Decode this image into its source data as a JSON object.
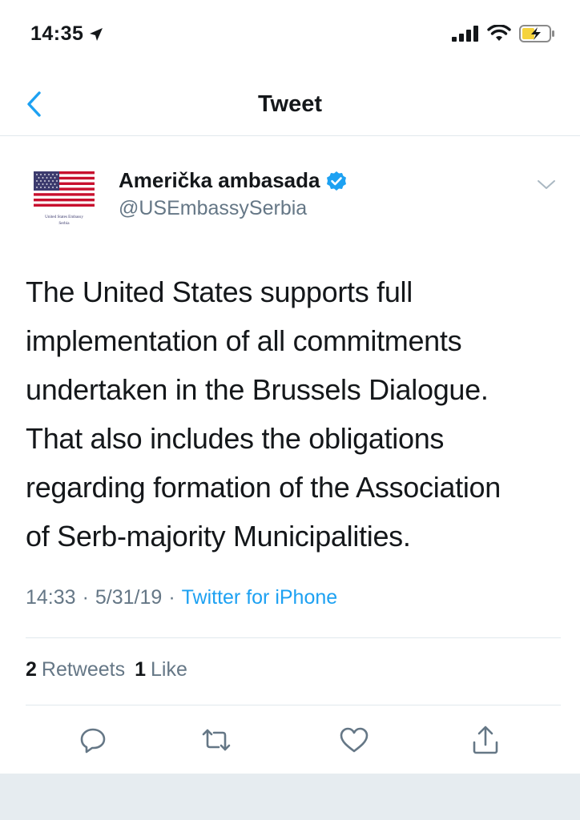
{
  "status_bar": {
    "time": "14:35",
    "icons": [
      "location-arrow-icon",
      "signal-icon",
      "wifi-icon",
      "battery-charging-icon"
    ]
  },
  "nav": {
    "title": "Tweet",
    "back_icon": "chevron-left-icon"
  },
  "tweet": {
    "author_name": "Američka ambasada",
    "author_handle": "@USEmbassySerbia",
    "avatar_caption_line1": "United States Embassy",
    "avatar_caption_line2": "Serbia",
    "verified_icon": "verified-badge-icon",
    "lines": [
      "The United States supports full",
      "implementation of all commitments",
      "undertaken in the Brussels Dialogue.",
      "That also includes the obligations",
      "regarding formation of the Association",
      "of Serb-majority Municipalities."
    ],
    "time": "14:33",
    "date": "5/31/19",
    "separator": "·",
    "source": "Twitter for iPhone"
  },
  "stats": {
    "retweets_count": "2",
    "retweets_label": "Retweets",
    "likes_count": "1",
    "likes_label": "Like"
  },
  "actions": [
    "reply-icon",
    "retweet-icon",
    "like-icon",
    "share-icon"
  ],
  "colors": {
    "accent": "#1da1f2",
    "text": "#14171a",
    "secondary": "#657786",
    "divider": "#e1e8ed",
    "battery": "#f5d33d"
  }
}
